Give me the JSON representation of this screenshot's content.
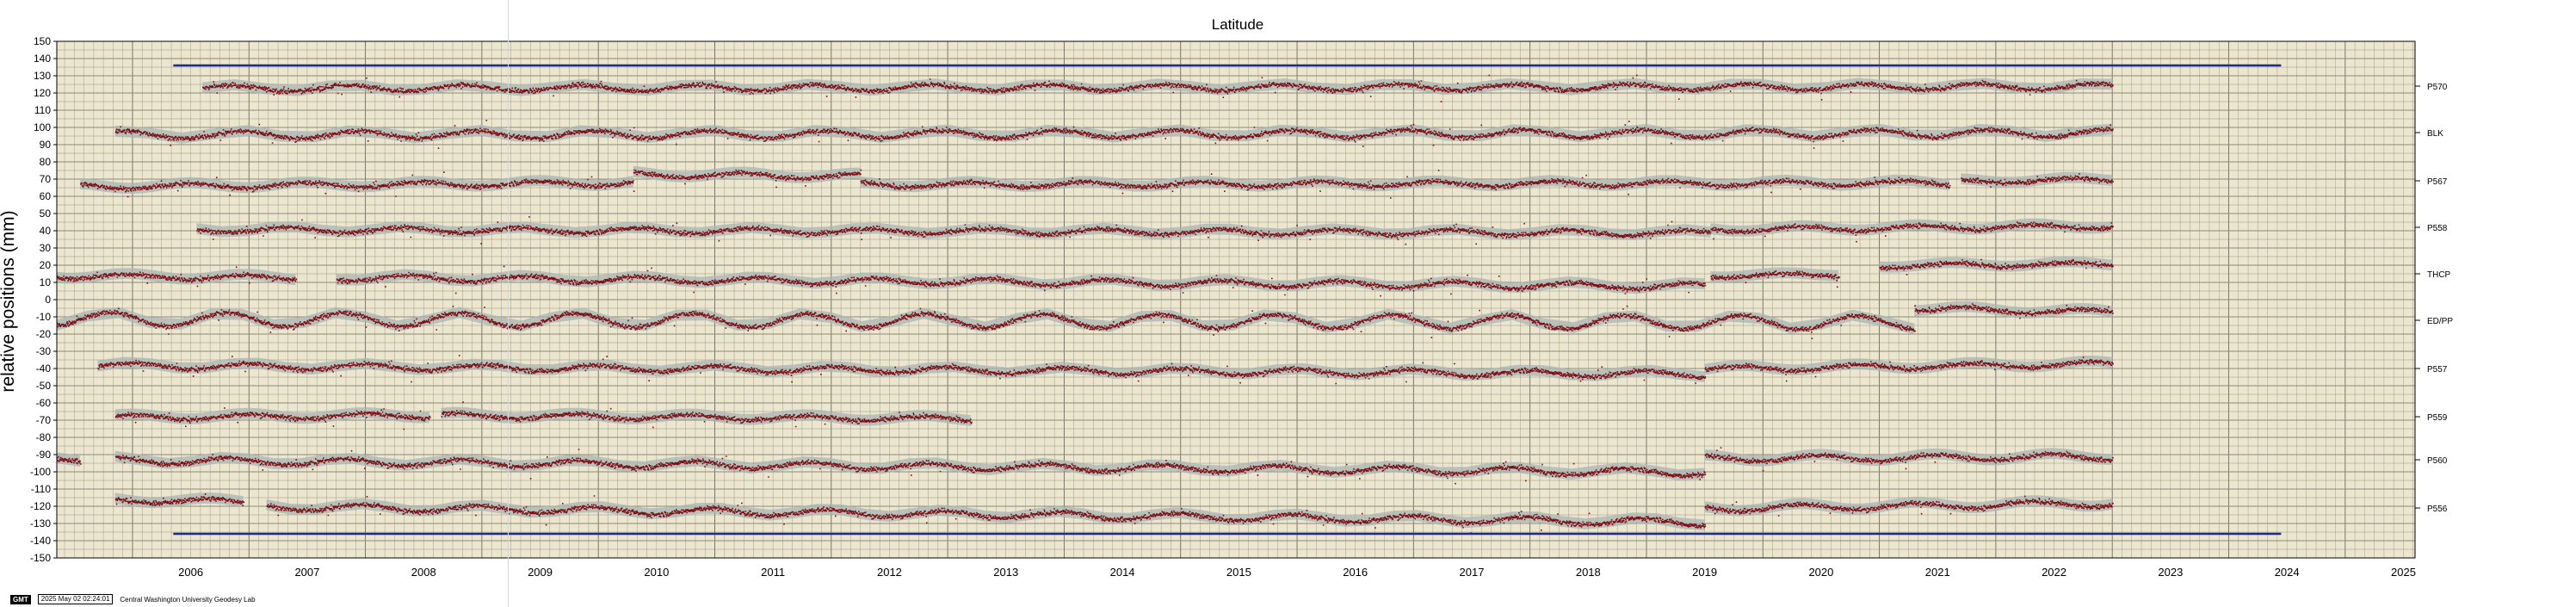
{
  "chart_data": {
    "type": "scatter",
    "title": "Latitude",
    "ylabel": "relative positions (mm)",
    "xlabel": "",
    "xlim": [
      2005.35,
      2025.6
    ],
    "ylim": [
      -150,
      150
    ],
    "y_ticks": [
      150,
      140,
      130,
      120,
      110,
      100,
      90,
      80,
      70,
      60,
      50,
      40,
      30,
      20,
      10,
      0,
      -10,
      -20,
      -30,
      -40,
      -50,
      -60,
      -70,
      -80,
      -90,
      -100,
      -110,
      -120,
      -130,
      -140,
      -150
    ],
    "x_ticks": [
      "2006",
      "2007",
      "2008",
      "2009",
      "2010",
      "2011",
      "2012",
      "2013",
      "2014",
      "2015",
      "2016",
      "2017",
      "2018",
      "2019",
      "2020",
      "2021",
      "2022",
      "2023",
      "2024",
      "2025"
    ],
    "grid": true,
    "background_color": "#ece6cf",
    "point_color": "#7a0f14",
    "envelope_color": "#aab4b4",
    "reference_line_color": "#1f2a8c",
    "reference_lines": [
      {
        "y": 136,
        "x_start": 2006.35,
        "x_end": 2024.45
      },
      {
        "y": -136,
        "x_start": 2006.35,
        "x_end": 2024.45
      }
    ],
    "series": [
      {
        "name": "P570",
        "segments": [
          {
            "start": 2006.6,
            "end": 2023.0,
            "y0": 123,
            "y1": 124,
            "amp": 1.8
          }
        ]
      },
      {
        "name": "BLK",
        "segments": [
          {
            "start": 2005.85,
            "end": 2023.0,
            "y0": 96,
            "y1": 97,
            "amp": 2.2
          }
        ]
      },
      {
        "name": "P567",
        "segments": [
          {
            "start": 2005.55,
            "end": 2010.3,
            "y0": 66,
            "y1": 68,
            "amp": 1.5
          },
          {
            "start": 2010.3,
            "end": 2012.25,
            "y0": 73,
            "y1": 72,
            "amp": 1.5
          },
          {
            "start": 2012.25,
            "end": 2021.6,
            "y0": 67,
            "y1": 68,
            "amp": 1.5
          },
          {
            "start": 2021.7,
            "end": 2023.0,
            "y0": 69,
            "y1": 70,
            "amp": 1.2
          }
        ]
      },
      {
        "name": "P558",
        "segments": [
          {
            "start": 2006.55,
            "end": 2019.55,
            "y0": 41,
            "y1": 39,
            "amp": 1.6
          },
          {
            "start": 2019.55,
            "end": 2023.0,
            "y0": 41,
            "y1": 43,
            "amp": 1.4
          }
        ]
      },
      {
        "name": "THCP",
        "segments": [
          {
            "start": 2005.35,
            "end": 2007.4,
            "y0": 14,
            "y1": 13,
            "amp": 1.5
          },
          {
            "start": 2007.75,
            "end": 2019.5,
            "y0": 13,
            "y1": 8,
            "amp": 1.8
          },
          {
            "start": 2019.55,
            "end": 2020.65,
            "y0": 14,
            "y1": 15,
            "amp": 1.0
          },
          {
            "start": 2021.0,
            "end": 2023.0,
            "y0": 20,
            "y1": 21,
            "amp": 1.2
          }
        ]
      },
      {
        "name": "EDPP",
        "segments": [
          {
            "start": 2005.35,
            "end": 2021.3,
            "y0": -11,
            "y1": -13,
            "amp": 4.0
          },
          {
            "start": 2021.3,
            "end": 2023.0,
            "y0": -5,
            "y1": -7,
            "amp": 1.5
          }
        ]
      },
      {
        "name": "P557",
        "segments": [
          {
            "start": 2005.7,
            "end": 2019.5,
            "y0": -38,
            "y1": -43,
            "amp": 1.8
          },
          {
            "start": 2019.5,
            "end": 2023.0,
            "y0": -40,
            "y1": -37,
            "amp": 1.5
          }
        ]
      },
      {
        "name": "P559",
        "segments": [
          {
            "start": 2005.85,
            "end": 2008.55,
            "y0": -68,
            "y1": -67,
            "amp": 1.5
          },
          {
            "start": 2008.65,
            "end": 2013.2,
            "y0": -67,
            "y1": -69,
            "amp": 1.5
          }
        ]
      },
      {
        "name": "P560",
        "segments": [
          {
            "start": 2005.35,
            "end": 2005.55,
            "y0": -93,
            "y1": -94,
            "amp": 1.0
          },
          {
            "start": 2005.85,
            "end": 2019.5,
            "y0": -93,
            "y1": -100,
            "amp": 2.0
          },
          {
            "start": 2019.5,
            "end": 2023.0,
            "y0": -92,
            "y1": -91,
            "amp": 1.8
          }
        ]
      },
      {
        "name": "P556",
        "segments": [
          {
            "start": 2005.85,
            "end": 2006.95,
            "y0": -116,
            "y1": -117,
            "amp": 1.5
          },
          {
            "start": 2007.15,
            "end": 2019.5,
            "y0": -120,
            "y1": -129,
            "amp": 2.0
          },
          {
            "start": 2019.5,
            "end": 2023.0,
            "y0": -121,
            "y1": -118,
            "amp": 1.8
          }
        ]
      }
    ],
    "station_labels": [
      {
        "text": "P570",
        "y": 124
      },
      {
        "text": "BLK",
        "y": 97
      },
      {
        "text": "P567",
        "y": 69
      },
      {
        "text": "P558",
        "y": 42
      },
      {
        "text": "THCP",
        "y": 15
      },
      {
        "text": "ED/PP",
        "y": -12
      },
      {
        "text": "P557",
        "y": -40
      },
      {
        "text": "P559",
        "y": -68
      },
      {
        "text": "P560",
        "y": -93
      },
      {
        "text": "P556",
        "y": -121
      }
    ]
  },
  "footer": {
    "badge": "GMT",
    "timestamp": "2025 May 02 02:24:01",
    "lab": "Central Washington University Geodesy Lab"
  }
}
